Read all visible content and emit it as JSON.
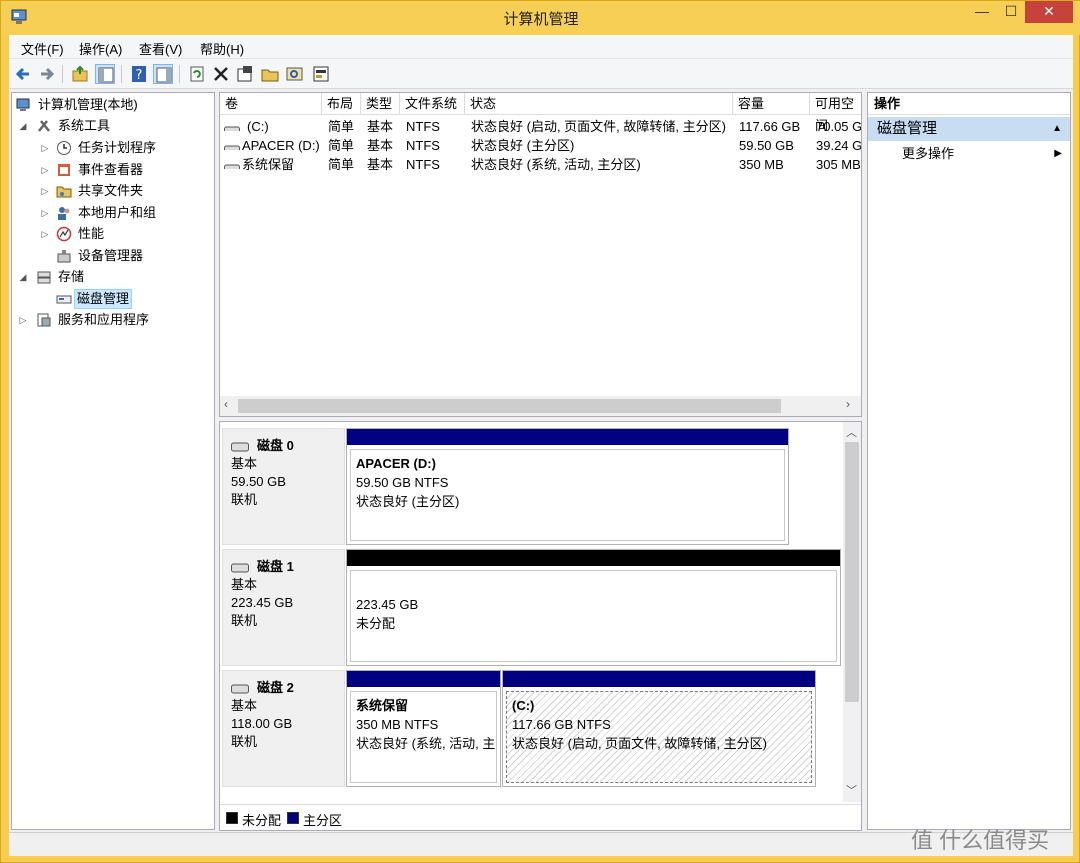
{
  "window": {
    "title": "计算机管理",
    "min": "—",
    "max": "☐",
    "close": "✕"
  },
  "menu": [
    "文件(F)",
    "操作(A)",
    "查看(V)",
    "帮助(H)"
  ],
  "tree": {
    "root": "计算机管理(本地)",
    "system_tools": "系统工具",
    "task_scheduler": "任务计划程序",
    "event_viewer": "事件查看器",
    "shared_folders": "共享文件夹",
    "local_users": "本地用户和组",
    "performance": "性能",
    "device_manager": "设备管理器",
    "storage": "存储",
    "disk_management": "磁盘管理",
    "services_apps": "服务和应用程序"
  },
  "volume_list": {
    "headers": [
      "卷",
      "布局",
      "类型",
      "文件系统",
      "状态",
      "容量",
      "可用空间"
    ],
    "rows": [
      [
        "(C:)",
        "简单",
        "基本",
        "NTFS",
        "状态良好 (启动, 页面文件, 故障转储, 主分区)",
        "117.66 GB",
        "70.05 G"
      ],
      [
        "APACER (D:)",
        "简单",
        "基本",
        "NTFS",
        "状态良好 (主分区)",
        "59.50 GB",
        "39.24 G"
      ],
      [
        "系统保留",
        "简单",
        "基本",
        "NTFS",
        "状态良好 (系统, 活动, 主分区)",
        "350 MB",
        "305 MB"
      ]
    ]
  },
  "disks": [
    {
      "name": "磁盘 0",
      "type": "基本",
      "size": "59.50 GB",
      "status": "联机"
    },
    {
      "name": "磁盘 1",
      "type": "基本",
      "size": "223.45 GB",
      "status": "联机"
    },
    {
      "name": "磁盘 2",
      "type": "基本",
      "size": "118.00 GB",
      "status": "联机"
    }
  ],
  "partitions": {
    "d": {
      "title": "APACER  (D:)",
      "size": "59.50 GB NTFS",
      "status": "状态良好 (主分区)"
    },
    "unalloc": {
      "size": "223.45 GB",
      "status": "未分配"
    },
    "reserved": {
      "title": "系统保留",
      "size": "350 MB NTFS",
      "status": "状态良好 (系统, 活动, 主"
    },
    "c": {
      "title": "(C:)",
      "size": "117.66 GB NTFS",
      "status": "状态良好 (启动, 页面文件, 故障转储, 主分区)"
    }
  },
  "legend": {
    "unallocated": "未分配",
    "primary": "主分区"
  },
  "colors": {
    "primary": "#000080",
    "unallocated": "#000000",
    "titlebar": "#f7cf55",
    "action_header": "#c9ddf2"
  },
  "actions": {
    "header": "操作",
    "group": "磁盘管理",
    "more": "更多操作"
  },
  "watermark": "值 什么值得买"
}
